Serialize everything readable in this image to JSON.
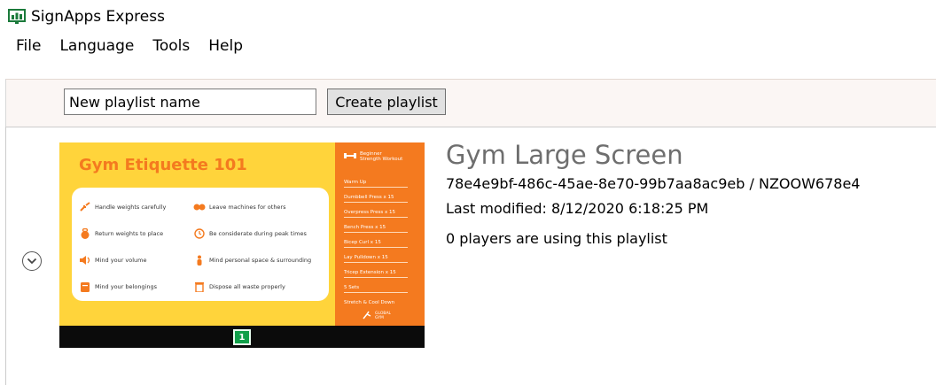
{
  "window": {
    "title": "SignApps Express",
    "brand_color": "#1b7a3b"
  },
  "menu": {
    "items": [
      "File",
      "Language",
      "Tools",
      "Help"
    ]
  },
  "toolbar": {
    "playlist_name_value": "New playlist name",
    "create_label": "Create playlist"
  },
  "playlist": {
    "name": "Gym Large Screen",
    "id_line": "78e4e9bf-486c-45ae-8e70-99b7aa8ac9eb / NZOOW678e4",
    "modified": "Last modified: 8/12/2020 6:18:25 PM",
    "players": "0 players are using this playlist",
    "expand_icon": "chevron-down-circle-icon",
    "thumbnail": {
      "title": "Gym Etiquette 101",
      "tips": [
        "Handle weights carefully",
        "Leave machines for others",
        "Return weights to place",
        "Be considerate during peak times",
        "Mind your volume",
        "Mind personal space & surrounding",
        "Mind your belongings",
        "Dispose all waste properly"
      ],
      "side_heading": "Beginner Strength Workout",
      "side_items": [
        "Warm Up",
        "Dumbbell Press x 15",
        "Overpress Press x 15",
        "Bench Press x 15",
        "Bicep Curl x 15",
        "Lay Pulldown x 15",
        "Tricep Extension x 15",
        "5 Sets",
        "Stretch & Cool Down"
      ],
      "side_logo": "GLOBAL GYM",
      "page_number": "1",
      "colors": {
        "yellow": "#ffd43b",
        "orange": "#f47a1f",
        "bar": "#0b0b0b",
        "page": "#11a04a"
      }
    }
  }
}
